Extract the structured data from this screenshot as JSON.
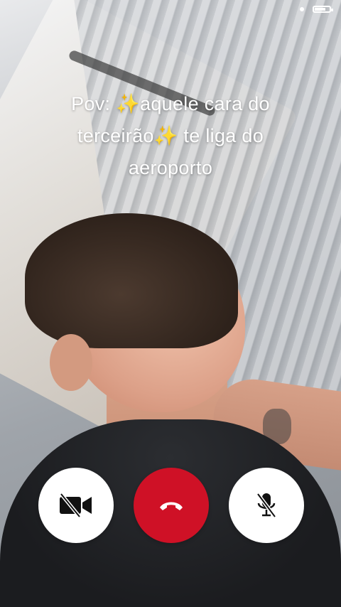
{
  "caption": {
    "line1": "Pov: ✨aquele cara do",
    "line2": "terceirão✨ te liga do",
    "line3": "aeroporto"
  },
  "controls": {
    "camera_icon": "camera-off-icon",
    "end_call_icon": "phone-hangup-icon",
    "mic_icon": "mic-off-icon",
    "end_call_color": "#cf1126"
  }
}
